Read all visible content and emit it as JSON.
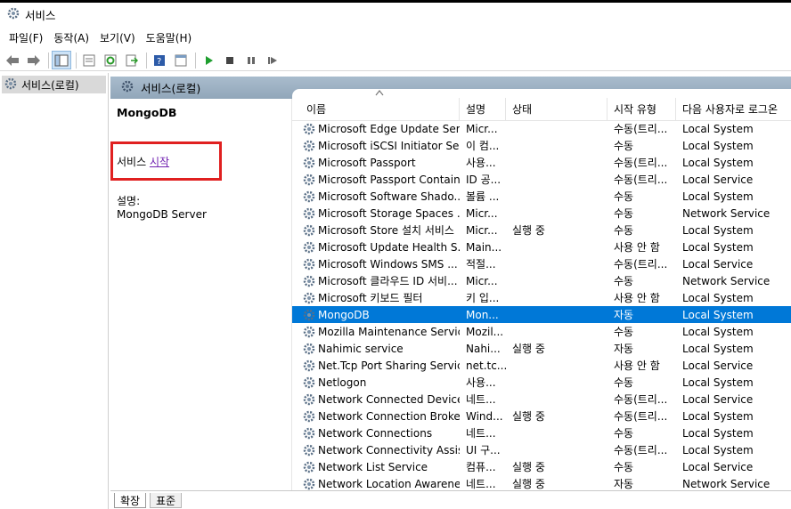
{
  "window": {
    "title": "서비스"
  },
  "menu": [
    "파일(F)",
    "동작(A)",
    "보기(V)",
    "도움말(H)"
  ],
  "toolbar_icons": [
    "back-icon",
    "forward-icon",
    "console-tree-icon",
    "properties-icon",
    "refresh-icon",
    "export-icon",
    "help-icon",
    "view-icon",
    "start-service-icon",
    "stop-service-icon",
    "pause-service-icon",
    "restart-service-icon"
  ],
  "tree": {
    "root": "서비스(로컬)"
  },
  "panel": {
    "header": "서비스(로컬)",
    "service_name": "MongoDB",
    "link_prefix": "서비스 ",
    "link_text": "시작",
    "desc_label": "설명:",
    "desc_value": "MongoDB Server"
  },
  "columns": [
    "이름",
    "설명",
    "상태",
    "시작 유형",
    "다음 사용자로 로그온"
  ],
  "services": [
    {
      "name": "Microsoft Edge Update Ser...",
      "desc": "Micr...",
      "status": "",
      "start": "수동(트리...",
      "logon": "Local System"
    },
    {
      "name": "Microsoft iSCSI Initiator Se...",
      "desc": "이 컴...",
      "status": "",
      "start": "수동",
      "logon": "Local System"
    },
    {
      "name": "Microsoft Passport",
      "desc": "사용...",
      "status": "",
      "start": "수동(트리...",
      "logon": "Local System"
    },
    {
      "name": "Microsoft Passport Container",
      "desc": "ID 공...",
      "status": "",
      "start": "수동(트리...",
      "logon": "Local Service"
    },
    {
      "name": "Microsoft Software Shado...",
      "desc": "볼륨 ...",
      "status": "",
      "start": "수동",
      "logon": "Local System"
    },
    {
      "name": "Microsoft Storage Spaces ...",
      "desc": "Micr...",
      "status": "",
      "start": "수동",
      "logon": "Network Service"
    },
    {
      "name": "Microsoft Store 설치 서비스",
      "desc": "Micr...",
      "status": "실행 중",
      "start": "수동",
      "logon": "Local System"
    },
    {
      "name": "Microsoft Update Health S...",
      "desc": "Main...",
      "status": "",
      "start": "사용 안 함",
      "logon": "Local System"
    },
    {
      "name": "Microsoft Windows SMS ...",
      "desc": "적절...",
      "status": "",
      "start": "수동(트리...",
      "logon": "Local Service"
    },
    {
      "name": "Microsoft 클라우드 ID 서비...",
      "desc": "Micr...",
      "status": "",
      "start": "수동",
      "logon": "Network Service"
    },
    {
      "name": "Microsoft 키보드 필터",
      "desc": "키 입...",
      "status": "",
      "start": "사용 안 함",
      "logon": "Local System"
    },
    {
      "name": "MongoDB",
      "desc": "Mon...",
      "status": "",
      "start": "자동",
      "logon": "Local System",
      "selected": true
    },
    {
      "name": "Mozilla Maintenance Service",
      "desc": "Mozil...",
      "status": "",
      "start": "수동",
      "logon": "Local System"
    },
    {
      "name": "Nahimic service",
      "desc": "Nahi...",
      "status": "실행 중",
      "start": "자동",
      "logon": "Local System"
    },
    {
      "name": "Net.Tcp Port Sharing Service",
      "desc": "net.tc...",
      "status": "",
      "start": "사용 안 함",
      "logon": "Local Service"
    },
    {
      "name": "Netlogon",
      "desc": "사용...",
      "status": "",
      "start": "수동",
      "logon": "Local System"
    },
    {
      "name": "Network Connected Device...",
      "desc": "네트...",
      "status": "",
      "start": "수동(트리...",
      "logon": "Local Service"
    },
    {
      "name": "Network Connection Broker",
      "desc": "Wind...",
      "status": "실행 중",
      "start": "수동(트리...",
      "logon": "Local System"
    },
    {
      "name": "Network Connections",
      "desc": "네트...",
      "status": "",
      "start": "수동",
      "logon": "Local System"
    },
    {
      "name": "Network Connectivity Assis...",
      "desc": "UI 구...",
      "status": "",
      "start": "수동(트리...",
      "logon": "Local System"
    },
    {
      "name": "Network List Service",
      "desc": "컴퓨...",
      "status": "실행 중",
      "start": "수동",
      "logon": "Local Service"
    },
    {
      "name": "Network Location Awareness",
      "desc": "네트...",
      "status": "실행 중",
      "start": "자동",
      "logon": "Network Service"
    }
  ],
  "tabs": [
    "확장",
    "표준"
  ]
}
